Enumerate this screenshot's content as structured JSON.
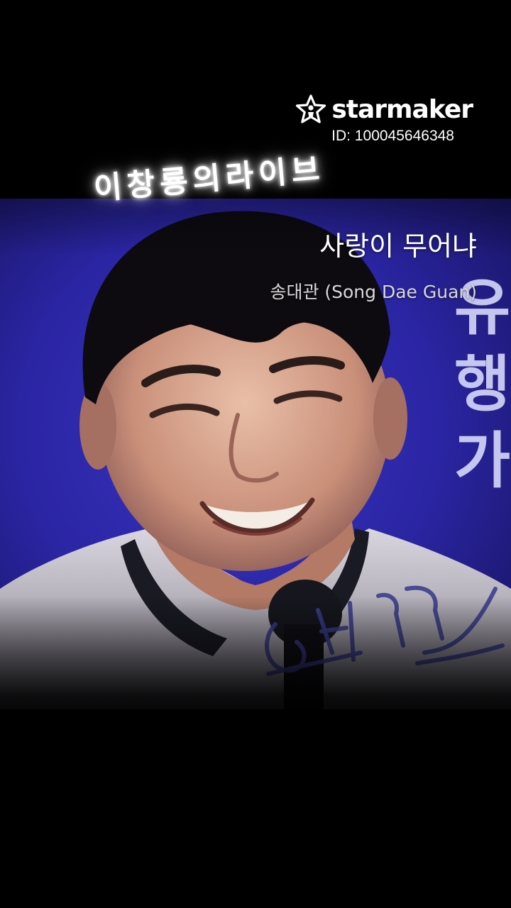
{
  "watermark": {
    "brand": "starmaker",
    "user_id": "ID: 100045646348",
    "logo_icon": "star-person-icon"
  },
  "banner": {
    "text": "이창룡의라이브"
  },
  "song": {
    "title": "사랑이 무어냐",
    "artist": "송대관 (Song Dae Guan)"
  },
  "stage_backdrop": {
    "letters": [
      "유",
      "행",
      "가"
    ]
  },
  "signature": {
    "text": "송대관"
  },
  "colors": {
    "background": "#000000",
    "stage_blue": "#2a26a8",
    "text": "#ffffff"
  }
}
